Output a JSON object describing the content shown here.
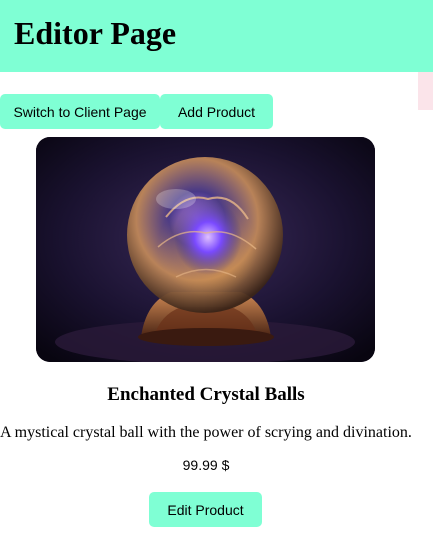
{
  "header": {
    "title": "Editor Page"
  },
  "nav": {
    "switch_label": "Switch to Client Page",
    "add_label": "Add Product"
  },
  "product": {
    "image_subject": "crystal-ball-image",
    "title": "Enchanted Crystal Balls",
    "description": "A mystical crystal ball with the power of scrying and divination.",
    "price": "99.99 $",
    "edit_label": "Edit Product"
  },
  "colors": {
    "accent": "#7fffd4",
    "strip": "#fbe4ea"
  }
}
